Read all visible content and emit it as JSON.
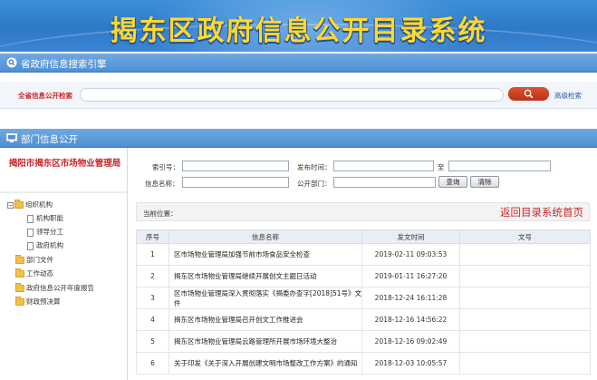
{
  "banner": {
    "title": "揭东区政府信息公开目录系统"
  },
  "search_section": {
    "title": "省政府信息搜索引擎",
    "label": "全省信息公开检索",
    "query": "",
    "advanced_label": "高级检索"
  },
  "dept_section": {
    "title": "部门信息公开"
  },
  "sidebar": {
    "department": "揭阳市揭东区市场物业管理局",
    "tree": [
      {
        "label": "组织机构",
        "expanded": true
      },
      {
        "label": "机构职能"
      },
      {
        "label": "领导分工"
      },
      {
        "label": "政府机构"
      },
      {
        "label": "部门文件"
      },
      {
        "label": "工作动态"
      },
      {
        "label": "政府信息公开年度报告"
      },
      {
        "label": "财政预决算"
      }
    ]
  },
  "filter_form": {
    "index_no_label": "索引号：",
    "publish_time_label": "发布时间：",
    "to_label": "至",
    "info_name_label": "信息名称：",
    "dept_label": "公开部门：",
    "query_button": "查询",
    "clear_button": "清除",
    "index_no_value": "",
    "date_from": "",
    "date_to": "",
    "info_name_value": "",
    "dept_value": ""
  },
  "breadcrumb": {
    "label": "当前位置：",
    "back_link": "返回目录系统首页"
  },
  "table": {
    "headers": [
      "序号",
      "信息名称",
      "发文时间",
      "文号"
    ],
    "rows": [
      {
        "no": "1",
        "name": "区市场物业管理局加强节前市场食品安全检查",
        "date": "2019-02-11 09:03:53",
        "doc_no": ""
      },
      {
        "no": "2",
        "name": "揭东区市场物业管理局继续开展创文主题日活动",
        "date": "2019-01-11 16:27:20",
        "doc_no": ""
      },
      {
        "no": "3",
        "name": "区市场物业管理局深入贯彻落实《揭委办查字[2018]51号》文件",
        "date": "2018-12-24 16:11:28",
        "doc_no": ""
      },
      {
        "no": "4",
        "name": "揭东区市场物业管理局召开创文工作推进会",
        "date": "2018-12-16 14:56:22",
        "doc_no": ""
      },
      {
        "no": "5",
        "name": "揭东区市场物业管理局云路管理所开展市场环境大整治",
        "date": "2018-12-16 09:02:49",
        "doc_no": ""
      },
      {
        "no": "6",
        "name": "关于印发《关于深入开展创建文明市场整改工作方案》的通知",
        "date": "2018-12-03 10:05:57",
        "doc_no": ""
      }
    ]
  },
  "colors": {
    "banner_blue": "#2e78c8",
    "banner_title": "#ffd830",
    "section_bar": "#4f8fd3",
    "accent_red": "#c8262a",
    "link_blue": "#1f57a6"
  }
}
